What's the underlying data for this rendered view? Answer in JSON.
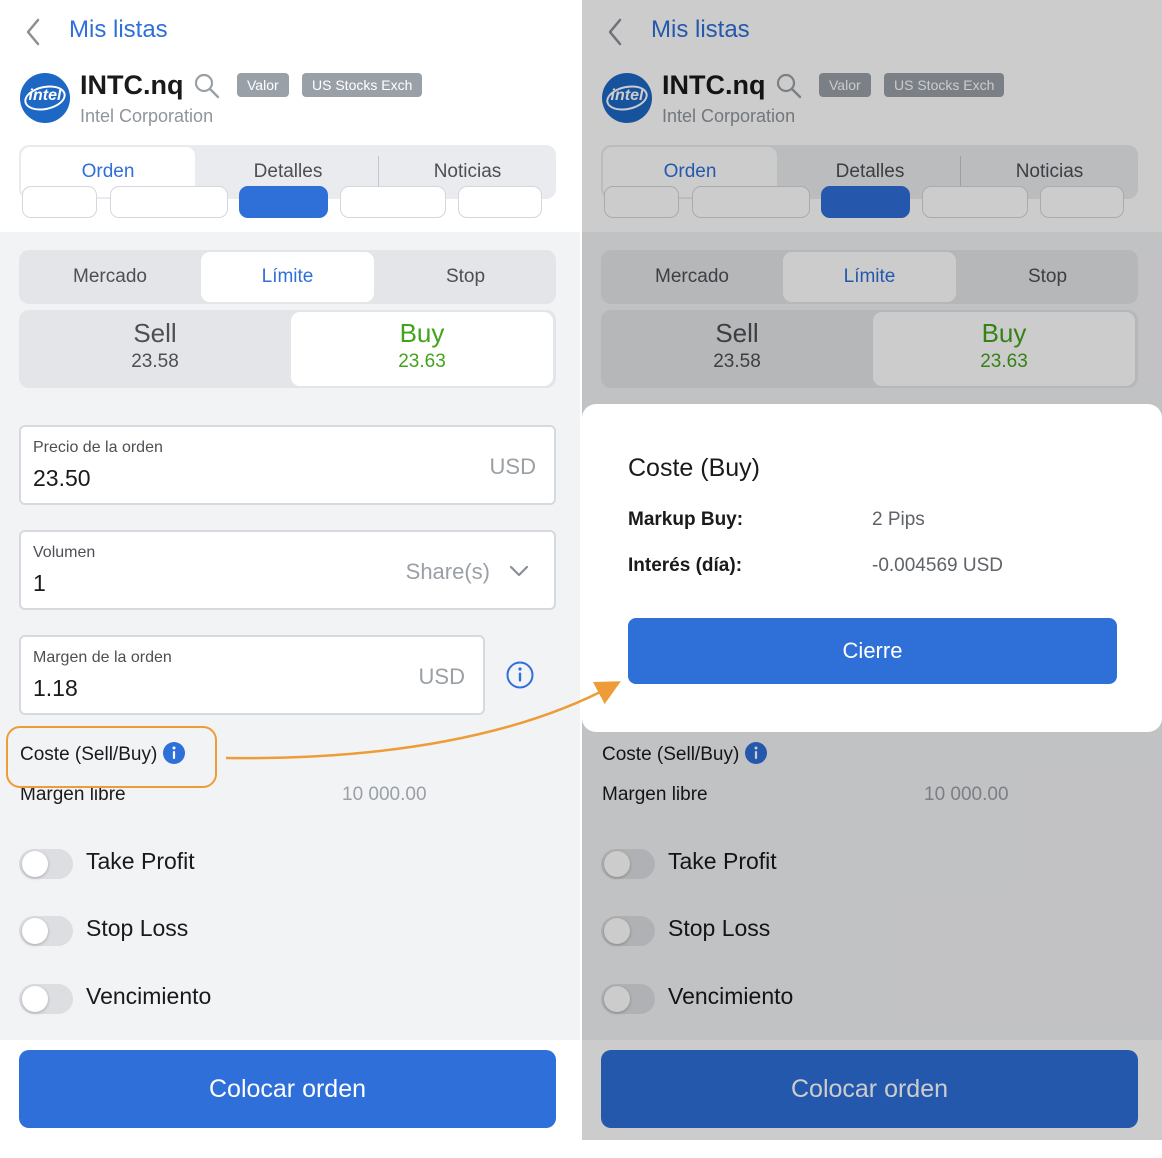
{
  "header": {
    "back_label": "Mis listas",
    "logo_text": "intel",
    "symbol": "INTC.nq",
    "company": "Intel Corporation",
    "badges": [
      "Valor",
      "US Stocks Exch"
    ]
  },
  "main_tabs": [
    "Orden",
    "Detalles",
    "Noticias"
  ],
  "order_types": [
    "Mercado",
    "Límite",
    "Stop"
  ],
  "sides": {
    "sell": {
      "label": "Sell",
      "price": "23.58"
    },
    "buy": {
      "label": "Buy",
      "price": "23.63"
    }
  },
  "fields": {
    "price": {
      "label": "Precio de la orden",
      "value": "23.50",
      "unit": "USD"
    },
    "volume": {
      "label": "Volumen",
      "value": "1",
      "unit": "Share(s)"
    },
    "margin": {
      "label": "Margen de la orden",
      "value": "1.18",
      "unit": "USD"
    }
  },
  "cost_label": "Coste (Sell/Buy)",
  "free_margin": {
    "label": "Margen libre",
    "value": "10 000.00"
  },
  "toggles": [
    "Take Profit",
    "Stop Loss",
    "Vencimiento"
  ],
  "place_button": "Colocar orden",
  "modal": {
    "title": "Coste (Buy)",
    "rows": [
      {
        "key": "Markup Buy:",
        "value": "2 Pips"
      },
      {
        "key": "Interés (día):",
        "value": "-0.004569 USD"
      }
    ],
    "close_label": "Cierre"
  },
  "colors": {
    "accent": "#2f6fd8",
    "buy_green": "#43a31b",
    "highlight_orange": "#ee9c37"
  }
}
